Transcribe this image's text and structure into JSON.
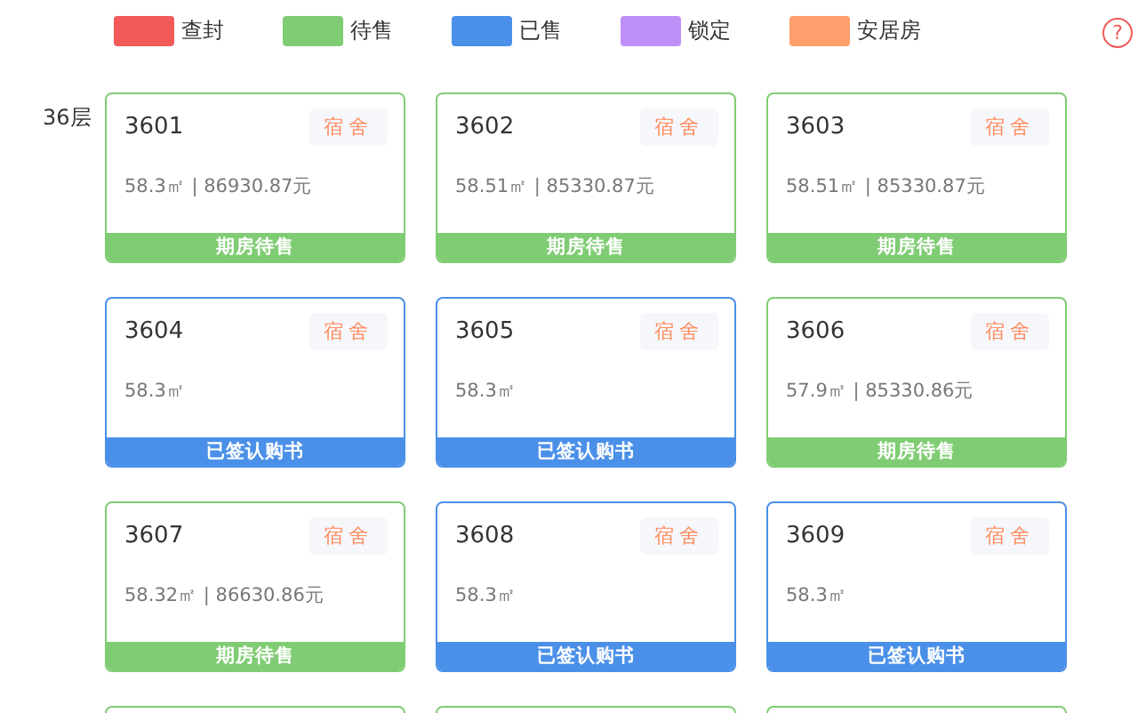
{
  "legend": [
    {
      "label": "查封",
      "color": "#f25a5a"
    },
    {
      "label": "待售",
      "color": "#80cc74"
    },
    {
      "label": "已售",
      "color": "#4a90e8"
    },
    {
      "label": "锁定",
      "color": "#bf8ff8"
    },
    {
      "label": "安居房",
      "color": "#ff9e6c"
    }
  ],
  "help_icon": "?",
  "floor": {
    "label": "36层",
    "units": [
      {
        "number": "3601",
        "tag": "宿舍",
        "info": "58.3㎡ | 86930.87元",
        "status": "期房待售",
        "kind": "available"
      },
      {
        "number": "3602",
        "tag": "宿舍",
        "info": "58.51㎡ | 85330.87元",
        "status": "期房待售",
        "kind": "available"
      },
      {
        "number": "3603",
        "tag": "宿舍",
        "info": "58.51㎡ | 85330.87元",
        "status": "期房待售",
        "kind": "available"
      },
      {
        "number": "3604",
        "tag": "宿舍",
        "info": "58.3㎡",
        "status": "已签认购书",
        "kind": "sold"
      },
      {
        "number": "3605",
        "tag": "宿舍",
        "info": "58.3㎡",
        "status": "已签认购书",
        "kind": "sold"
      },
      {
        "number": "3606",
        "tag": "宿舍",
        "info": "57.9㎡ | 85330.86元",
        "status": "期房待售",
        "kind": "available"
      },
      {
        "number": "3607",
        "tag": "宿舍",
        "info": "58.32㎡ | 86630.86元",
        "status": "期房待售",
        "kind": "available"
      },
      {
        "number": "3608",
        "tag": "宿舍",
        "info": "58.3㎡",
        "status": "已签认购书",
        "kind": "sold"
      },
      {
        "number": "3609",
        "tag": "宿舍",
        "info": "58.3㎡",
        "status": "已签认购书",
        "kind": "sold"
      }
    ],
    "cut_row": [
      {
        "kind": "available"
      },
      {
        "kind": "available"
      },
      {
        "kind": "available"
      }
    ]
  }
}
